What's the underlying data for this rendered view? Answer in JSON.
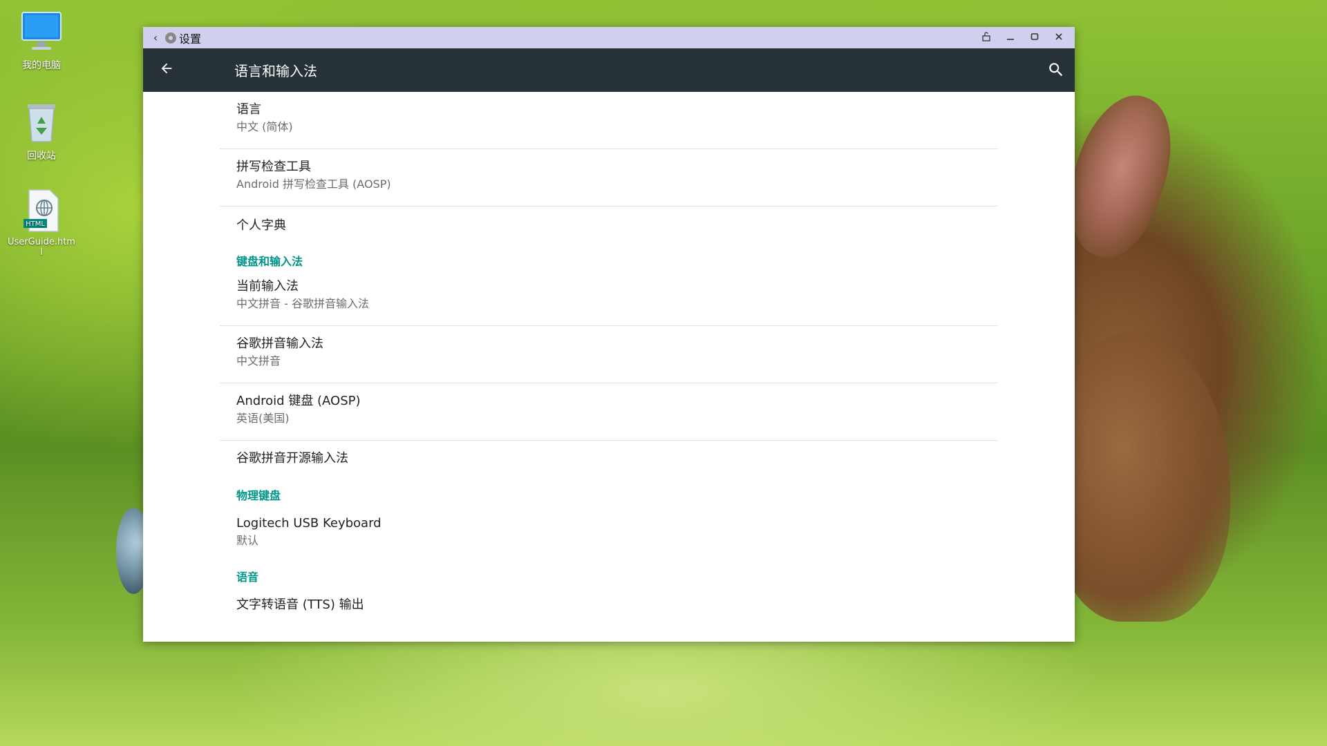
{
  "desktop": {
    "icons": [
      {
        "label": "我的电脑"
      },
      {
        "label": "回收站"
      },
      {
        "label": "UserGuide.html",
        "badge": "HTML"
      }
    ]
  },
  "window": {
    "title": "设置",
    "controls": [
      "pin-icon",
      "minimize-icon",
      "maximize-icon",
      "close-icon"
    ]
  },
  "appbar": {
    "title": "语言和输入法"
  },
  "sections": {
    "top": [
      {
        "title": "语言",
        "summary": "中文 (简体)"
      },
      {
        "title": "拼写检查工具",
        "summary": "Android 拼写检查工具 (AOSP)"
      },
      {
        "title": "个人字典"
      }
    ],
    "keyboard": {
      "header": "键盘和输入法",
      "items": [
        {
          "title": "当前输入法",
          "summary": "中文拼音 - 谷歌拼音输入法"
        },
        {
          "title": "谷歌拼音输入法",
          "summary": "中文拼音"
        },
        {
          "title": "Android 键盘 (AOSP)",
          "summary": "英语(美国)"
        },
        {
          "title": "谷歌拼音开源输入法"
        }
      ]
    },
    "physical": {
      "header": "物理键盘",
      "items": [
        {
          "title": "Logitech USB Keyboard",
          "summary": "默认"
        }
      ]
    },
    "speech": {
      "header": "语音",
      "items": [
        {
          "title": "文字转语音 (TTS) 输出"
        }
      ]
    }
  },
  "colors": {
    "appbar": "#263238",
    "titlebar": "#cfd0ee",
    "category": "#009688"
  }
}
